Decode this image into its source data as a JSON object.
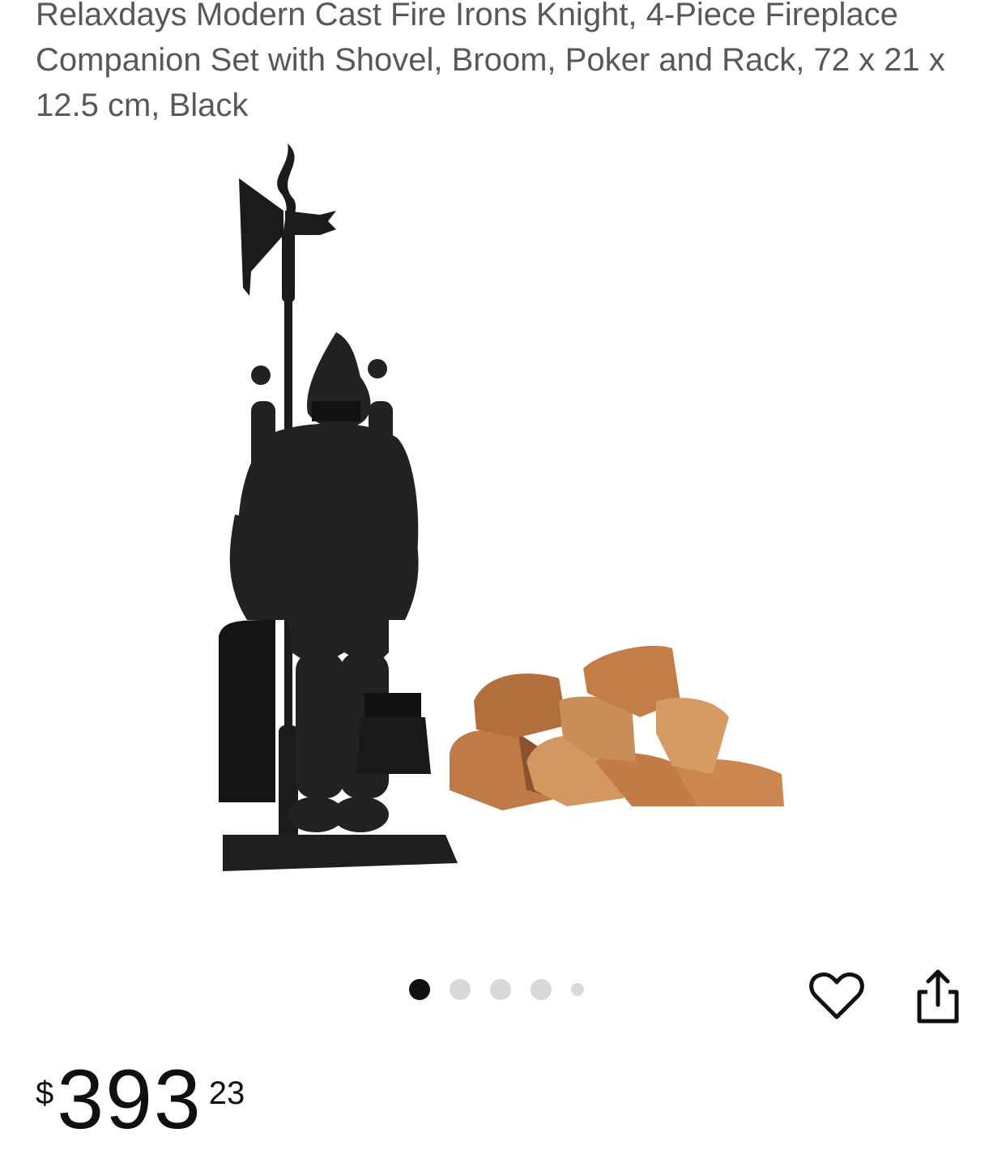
{
  "product": {
    "title": "Relaxdays Modern Cast Fire Irons Knight, 4-Piece Fireplace Companion Set with Shovel, Broom, Poker and Rack, 72 x 21 x 12.5 cm, Black"
  },
  "gallery": {
    "image_count": 5,
    "active_index": 0
  },
  "actions": {
    "favorite_icon": "heart-outline-icon",
    "share_icon": "share-icon"
  },
  "price": {
    "symbol": "$",
    "whole": "393",
    "fraction": "23"
  },
  "colors": {
    "text": "#0f1111",
    "title": "#565959",
    "dot_inactive": "#d5d9d9"
  }
}
